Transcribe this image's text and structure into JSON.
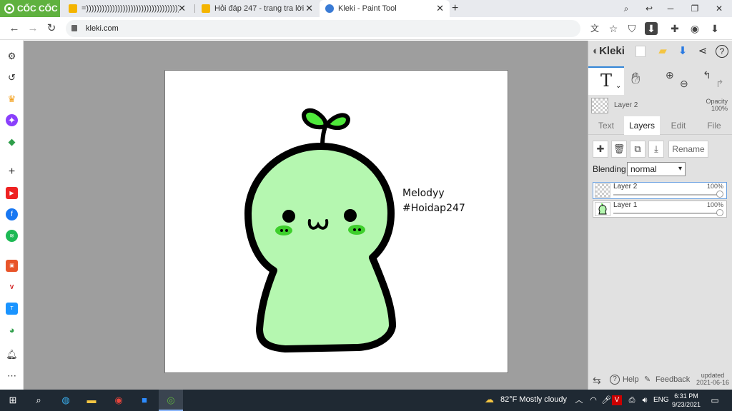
{
  "browser": {
    "brand": "CỐC CỐC",
    "tabs": [
      {
        "title": "=))))))))))))))))))))))))))))))))))))))))))))))",
        "favicon": "hoidap247-icon",
        "active": false
      },
      {
        "title": "Hỏi đáp 247 - trang tra lời",
        "favicon": "hoidap247-icon",
        "active": false
      },
      {
        "title": "Kleki - Paint Tool",
        "favicon": "kleki-icon",
        "active": true
      }
    ],
    "new_tab": "+",
    "address": "kleki.com"
  },
  "canvas": {
    "signature_line1": "Melodyy",
    "signature_line2": "#Hoidap247",
    "drawing_fill": "#b5f7b0",
    "leaf_color": "#4ee83a",
    "cheek_color": "#3ecf2c"
  },
  "panel": {
    "logo": "Kleki",
    "current_layer": "Layer 2",
    "opacity_label": "Opacity",
    "opacity_value": "100%",
    "tabs": [
      "Text",
      "Layers",
      "Edit",
      "File"
    ],
    "active_tab": "Layers",
    "rename_label": "Rename",
    "blending_label": "Blending",
    "blending_value": "normal",
    "layers": [
      {
        "name": "Layer 2",
        "opacity": "100%",
        "selected": true
      },
      {
        "name": "Layer 1",
        "opacity": "100%",
        "selected": false
      }
    ],
    "footer": {
      "help": "Help",
      "feedback": "Feedback",
      "updated_line1": "updated",
      "updated_line2": "2021-06-16"
    }
  },
  "taskbar": {
    "weather": "82°F  Mostly cloudy",
    "language": "ENG",
    "time": "6:31 PM",
    "date": "9/23/2021"
  },
  "colors": {
    "brand_green": "#5fb13f",
    "accent_blue": "#3385d6",
    "workspace_gray": "#9e9e9e"
  }
}
